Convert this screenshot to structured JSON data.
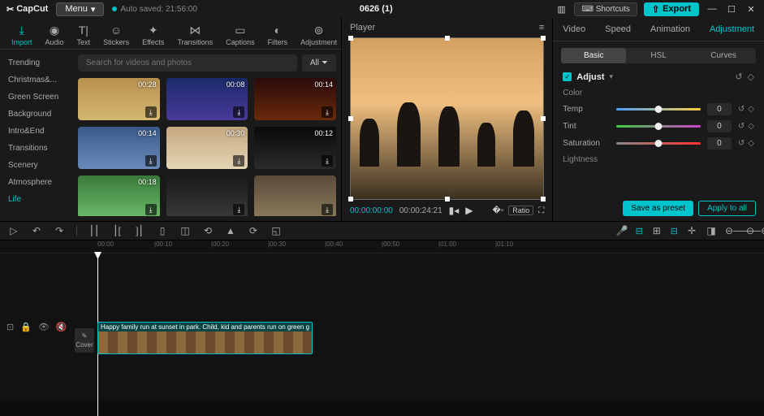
{
  "titlebar": {
    "app": "CapCut",
    "menu": "Menu",
    "autosave": "Auto saved: 21:56:00",
    "project": "0626 (1)",
    "shortcuts": "Shortcuts",
    "export": "Export"
  },
  "tabs": [
    {
      "label": "Import",
      "icon": "⤓"
    },
    {
      "label": "Audio",
      "icon": "◉"
    },
    {
      "label": "Text",
      "icon": "T|"
    },
    {
      "label": "Stickers",
      "icon": "☺"
    },
    {
      "label": "Effects",
      "icon": "✦"
    },
    {
      "label": "Transitions",
      "icon": "⋈"
    },
    {
      "label": "Captions",
      "icon": "▭"
    },
    {
      "label": "Filters",
      "icon": "◐"
    },
    {
      "label": "Adjustment",
      "icon": "⊚"
    }
  ],
  "sidebar": [
    "Trending",
    "Christmas&...",
    "Green Screen",
    "Background",
    "Intro&End",
    "Transitions",
    "Scenery",
    "Atmosphere",
    "Life"
  ],
  "search": {
    "placeholder": "Search for videos and photos",
    "all": "All"
  },
  "thumbs": [
    {
      "dur": "00:28",
      "bg": "linear-gradient(#b89050,#d4b870)"
    },
    {
      "dur": "00:08",
      "bg": "linear-gradient(#1a2a6a,#4a3a9a)"
    },
    {
      "dur": "00:14",
      "bg": "linear-gradient(#2a0a0a,#6a2a0a)"
    },
    {
      "dur": "00:14",
      "bg": "linear-gradient(#3a5a8a,#6a8aba)"
    },
    {
      "dur": "00:30",
      "bg": "linear-gradient(#c5a880,#e5d5b5)"
    },
    {
      "dur": "00:12",
      "bg": "linear-gradient(#0a0a0a,#2a2a2a)"
    },
    {
      "dur": "00:18",
      "bg": "linear-gradient(#3a7a3a,#6aba6a)"
    },
    {
      "dur": "",
      "bg": "linear-gradient(#1a1a1a,#3a3a3a)"
    },
    {
      "dur": "",
      "bg": "linear-gradient(#5a4a3a,#8a7a5a)"
    }
  ],
  "player": {
    "title": "Player",
    "tc_current": "00:00:00:00",
    "tc_total": "00:00:24:21",
    "ratio": "Ratio"
  },
  "right": {
    "tabs": [
      "Video",
      "Speed",
      "Animation",
      "Adjustment"
    ],
    "subtabs": [
      "Basic",
      "HSL",
      "Curves"
    ],
    "adjust": "Adjust",
    "color": "Color",
    "lightness": "Lightness",
    "sliders": [
      {
        "label": "Temp",
        "val": "0",
        "grad": "linear-gradient(90deg,#4aa0ff,#ffcc40)"
      },
      {
        "label": "Tint",
        "val": "0",
        "grad": "linear-gradient(90deg,#40cc40,#cc40cc)"
      },
      {
        "label": "Saturation",
        "val": "0",
        "grad": "linear-gradient(90deg,#888,#ff3030)"
      }
    ],
    "preset": "Save as preset",
    "apply": "Apply to all"
  },
  "timeline": {
    "ruler": [
      "00:00",
      "|00:10",
      "|00:20",
      "|00:30",
      "|00:40",
      "|00:50",
      "|01:00",
      "|01:10"
    ],
    "cover": "Cover",
    "clip_label": "Happy family run at sunset in park. Child, kid and parents run on green g"
  }
}
